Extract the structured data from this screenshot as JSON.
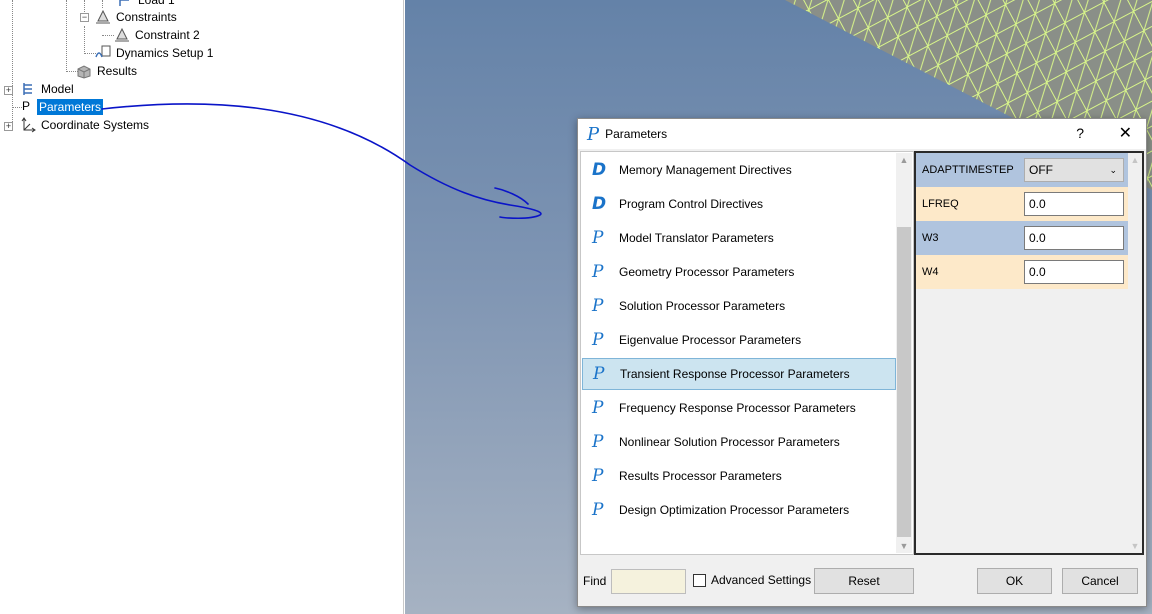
{
  "tree": {
    "items": [
      {
        "label": "Load 1"
      },
      {
        "label": "Constraints"
      },
      {
        "label": "Constraint 2"
      },
      {
        "label": "Dynamics Setup 1"
      },
      {
        "label": "Results"
      },
      {
        "label": "Model"
      },
      {
        "label": "Parameters",
        "prefix": "P"
      },
      {
        "label": "Coordinate Systems"
      }
    ]
  },
  "dialog": {
    "icon_letter": "P",
    "title": "Parameters",
    "help": "?",
    "close": "✕",
    "list": [
      {
        "icon": "D",
        "label": "Memory Management Directives"
      },
      {
        "icon": "D",
        "label": "Program Control Directives"
      },
      {
        "icon": "P",
        "label": "Model Translator Parameters"
      },
      {
        "icon": "P",
        "label": "Geometry Processor Parameters"
      },
      {
        "icon": "P",
        "label": "Solution Processor Parameters"
      },
      {
        "icon": "P",
        "label": "Eigenvalue Processor Parameters"
      },
      {
        "icon": "P",
        "label": "Transient Response Processor Parameters"
      },
      {
        "icon": "P",
        "label": "Frequency Response Processor Parameters"
      },
      {
        "icon": "P",
        "label": "Nonlinear Solution Processor Parameters"
      },
      {
        "icon": "P",
        "label": "Results Processor Parameters"
      },
      {
        "icon": "P",
        "label": "Design Optimization Processor Parameters"
      }
    ],
    "params": [
      {
        "name": "ADAPTTIMESTEP",
        "value": "OFF"
      },
      {
        "name": "LFREQ",
        "value": "0.0"
      },
      {
        "name": "W3",
        "value": "0.0"
      },
      {
        "name": "W4",
        "value": "0.0"
      }
    ],
    "footer": {
      "find_label": "Find",
      "find_value": "",
      "advanced_label": "Advanced Settings",
      "reset_label": "Reset",
      "ok_label": "OK",
      "cancel_label": "Cancel"
    }
  },
  "colors": {
    "selection": "#0078d7",
    "list_selection": "#cce4f0",
    "param_blue": "#b0c4de",
    "param_cream": "#fde9c9",
    "mesh": "#d8f58a",
    "annotation": "#0a14c8"
  }
}
